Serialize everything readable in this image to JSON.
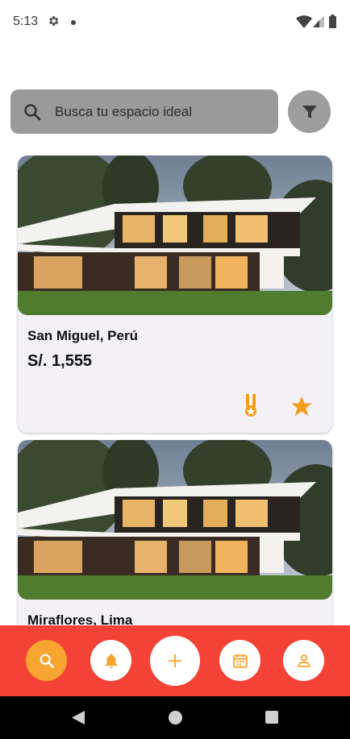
{
  "status_bar": {
    "time": "5:13"
  },
  "search": {
    "placeholder": "Busca tu espacio ideal"
  },
  "listings": [
    {
      "location": "San Miguel, Perú",
      "price": "S/. 1,555"
    },
    {
      "location": "Miraflores, Lima"
    }
  ],
  "colors": {
    "accent_red": "#f44336",
    "accent_orange": "#f7a430",
    "search_bg": "#9a9a9a",
    "card_bg": "#f3f0f6"
  },
  "icons": {
    "status": [
      "gear-icon",
      "wifi-icon",
      "signal-icon",
      "battery-icon"
    ],
    "search_bar": [
      "search-icon",
      "filter-icon"
    ],
    "card_actions": [
      "medal-icon",
      "star-icon"
    ],
    "bottom_nav": [
      "search-icon",
      "bell-icon",
      "plus-icon",
      "calendar-icon",
      "person-icon"
    ],
    "system_nav": [
      "back-icon",
      "home-icon",
      "recents-icon"
    ]
  }
}
